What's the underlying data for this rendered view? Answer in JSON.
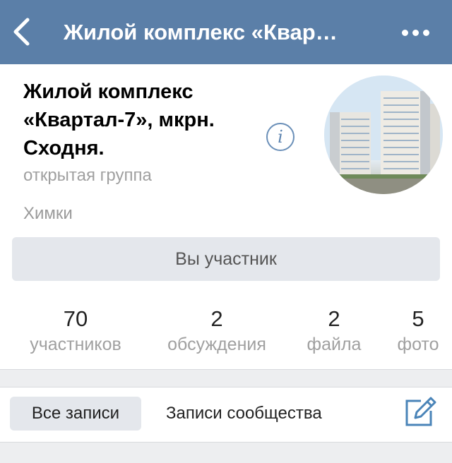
{
  "header": {
    "title": "Жилой комплекс «Квар…",
    "back_icon": "chevron-left-icon",
    "more_icon": "more-horizontal-icon"
  },
  "group": {
    "name_lines": [
      "Жилой комплекс",
      "«Квартал-7», мкрн.",
      "Сходня."
    ],
    "type": "открытая группа",
    "city": "Химки",
    "info_glyph": "i"
  },
  "member_button": {
    "label": "Вы участник"
  },
  "counters": [
    {
      "value": "70",
      "label": "участников"
    },
    {
      "value": "2",
      "label": "обсуждения"
    },
    {
      "value": "2",
      "label": "файла"
    },
    {
      "value": "5",
      "label": "фото"
    }
  ],
  "tabs": {
    "all": "Все записи",
    "community": "Записи сообщества",
    "compose_icon": "compose-icon"
  },
  "colors": {
    "header_bg": "#5b7fa8",
    "accent": "#5d84b0",
    "button_bg": "#e4e7ec",
    "muted_text": "#a0a0a0"
  }
}
